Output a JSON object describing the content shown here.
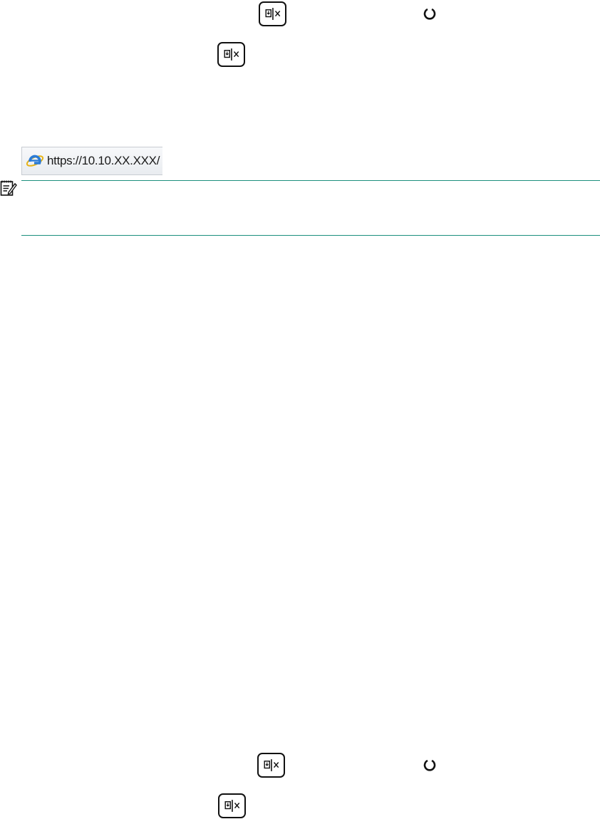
{
  "address_bar": {
    "url": "https://10.10.XX.XXX/",
    "browser_icon": "internet-explorer-icon"
  },
  "icons": {
    "cancel_button": "cancel-button-icon",
    "resume_light": "resume-light-icon",
    "note": "note-icon"
  },
  "colors": {
    "note_rule": "#1c8f7d",
    "ie_blue": "#2b7bd6",
    "ie_gold": "#e7b316"
  }
}
